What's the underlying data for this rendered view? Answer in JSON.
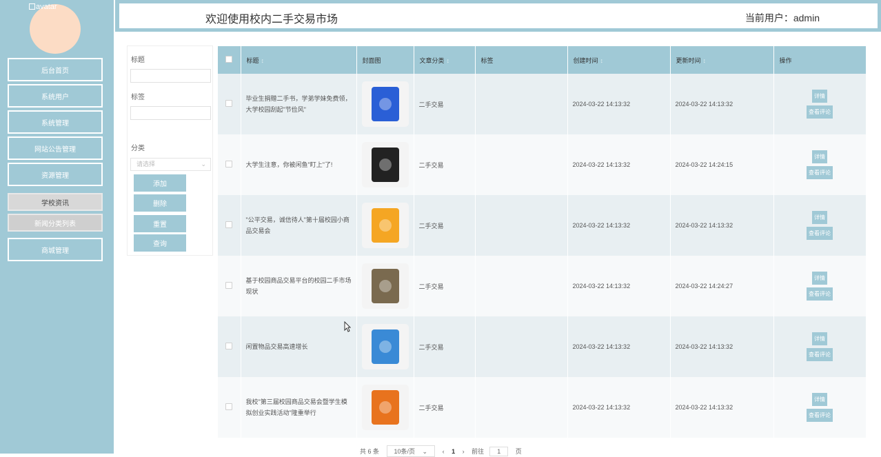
{
  "sidebar": {
    "avatar_alt": "avatar",
    "items": [
      {
        "label": "后台首页"
      },
      {
        "label": "系统用户"
      },
      {
        "label": "系统管理"
      },
      {
        "label": "网站公告管理"
      },
      {
        "label": "资源管理"
      },
      {
        "label": "学校资讯"
      },
      {
        "label": "新闻分类列表"
      },
      {
        "label": "商城管理"
      }
    ]
  },
  "header": {
    "title": "欢迎使用校内二手交易市场",
    "user": "当前用户：admin"
  },
  "filters": {
    "title_label": "标题",
    "tag_label": "标签",
    "category_label": "分类",
    "category_placeholder": "请选择",
    "buttons": {
      "add": "添加",
      "delete": "删除",
      "reset": "重置",
      "query": "查询"
    }
  },
  "table": {
    "headers": {
      "title": "标题",
      "cover": "封面图",
      "category": "文章分类",
      "tags": "标签",
      "created": "创建时间",
      "updated": "更新时间",
      "ops": "操作"
    },
    "rows": [
      {
        "title": "毕业生捐赠二手书，学弟学妹免费领，大学校园刮起\"节俭风\"",
        "category": "二手交易",
        "tags": "",
        "created": "2024-03-22 14:13:32",
        "updated": "2024-03-22 14:13:32",
        "cover_color": "#2a5fd6"
      },
      {
        "title": "大学生注意，你被闲鱼\"盯上\"了!",
        "category": "二手交易",
        "tags": "",
        "created": "2024-03-22 14:13:32",
        "updated": "2024-03-22 14:24:15",
        "cover_color": "#222222"
      },
      {
        "title": "\"公平交易，诚信待人\"第十届校园小商品交易会",
        "category": "二手交易",
        "tags": "",
        "created": "2024-03-22 14:13:32",
        "updated": "2024-03-22 14:13:32",
        "cover_color": "#f5a623"
      },
      {
        "title": "基于校园商品交易平台的校园二手市场现状",
        "category": "二手交易",
        "tags": "",
        "created": "2024-03-22 14:13:32",
        "updated": "2024-03-22 14:24:27",
        "cover_color": "#7a6a4f"
      },
      {
        "title": "闲置物品交易高速增长",
        "category": "二手交易",
        "tags": "",
        "created": "2024-03-22 14:13:32",
        "updated": "2024-03-22 14:13:32",
        "cover_color": "#3a8ad6"
      },
      {
        "title": "我校\"第三届校园商品交易会暨学生模拟创业实践活动\"隆重举行",
        "category": "二手交易",
        "tags": "",
        "created": "2024-03-22 14:13:32",
        "updated": "2024-03-22 14:13:32",
        "cover_color": "#e8731e"
      }
    ],
    "op_detail": "详情",
    "op_comments": "查看评论"
  },
  "pager": {
    "total": "共 6 条",
    "page_size": "10条/页",
    "current": "1",
    "goto_prefix": "前往",
    "goto_value": "1",
    "goto_suffix": "页"
  },
  "colors": {
    "accent": "#a0c9d6",
    "avatar": "#fcdcc5"
  }
}
